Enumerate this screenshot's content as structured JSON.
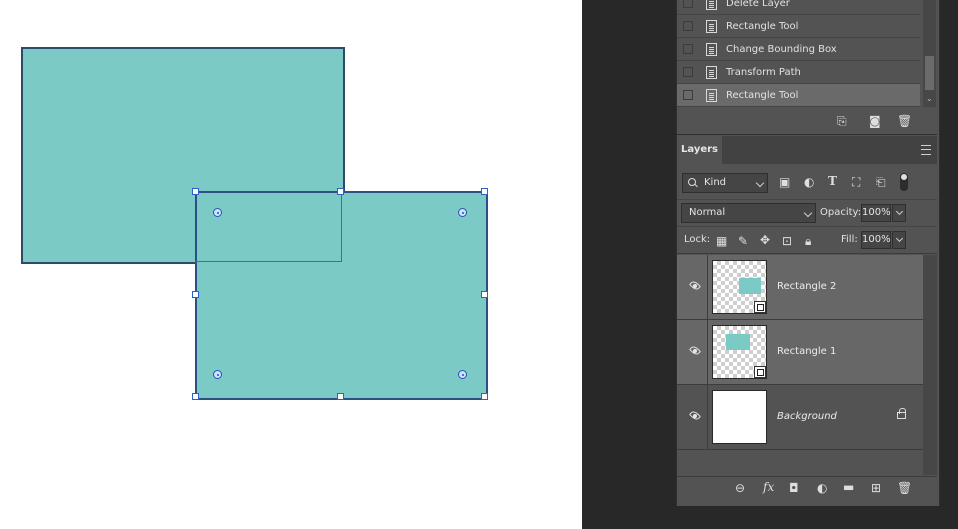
{
  "history": {
    "items": [
      {
        "label": "Delete Layer"
      },
      {
        "label": "Rectangle Tool"
      },
      {
        "label": "Change Bounding Box"
      },
      {
        "label": "Transform Path"
      },
      {
        "label": "Rectangle Tool"
      }
    ],
    "selected_index": 4,
    "footer_icons": [
      "new-document-from-state-icon",
      "camera-snapshot-icon",
      "trash-icon"
    ]
  },
  "layers_panel": {
    "tab_label": "Layers",
    "filter": {
      "kind_label": "Kind",
      "filter_icons": [
        "image-filter-icon",
        "adjustment-filter-icon",
        "type-filter-icon",
        "shape-filter-icon",
        "smart-object-filter-icon"
      ]
    },
    "blend_mode": "Normal",
    "opacity_label": "Opacity:",
    "opacity_value": "100%",
    "lock_label": "Lock:",
    "fill_label": "Fill:",
    "fill_value": "100%",
    "layers": [
      {
        "name": "Rectangle 2",
        "selected": true
      },
      {
        "name": "Rectangle 1",
        "selected": true
      },
      {
        "name": "Background",
        "selected": false,
        "locked": true
      }
    ],
    "footer_icons": [
      "link-layers-icon",
      "fx-icon",
      "mask-icon",
      "adjustment-layer-icon",
      "group-folder-icon",
      "new-layer-icon",
      "trash-icon"
    ],
    "fx_label": "fx"
  },
  "colors": {
    "shape_fill": "#7ccac6",
    "panel_bg": "#535353",
    "selection_blue": "#2b62c9"
  }
}
